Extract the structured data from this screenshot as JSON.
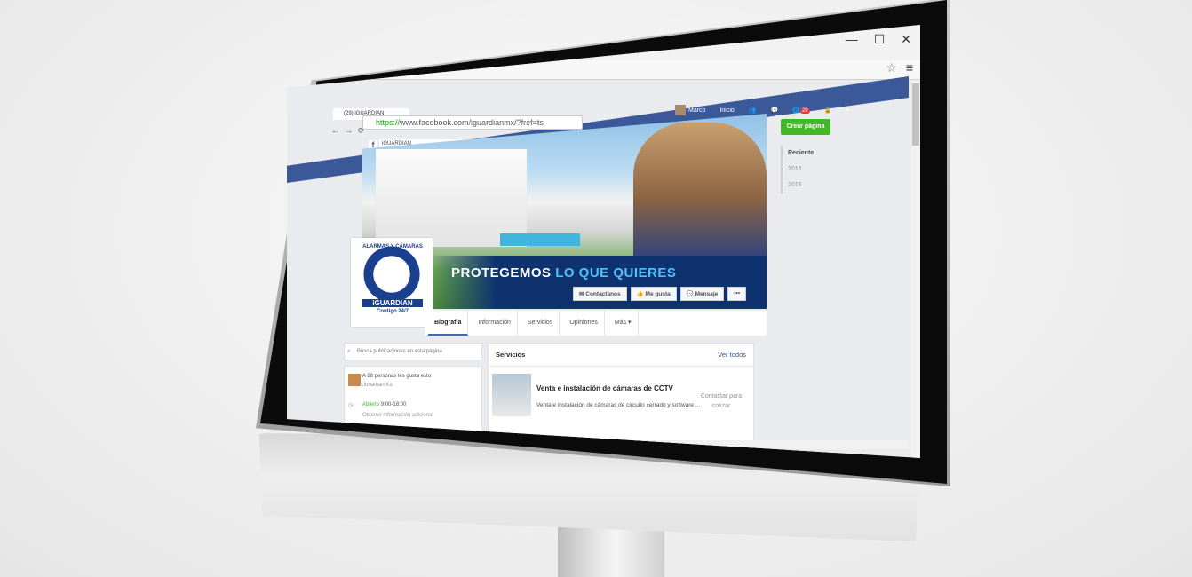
{
  "browser": {
    "tab_title": "(29) iGUARDIAN",
    "url_https": "https://",
    "url_rest": "www.facebook.com/iguardianmx/?fref=ts",
    "window_controls": [
      "—",
      "☐",
      "✕"
    ]
  },
  "facebook": {
    "search_value": "iGUARDIAN",
    "user_name": "Marco",
    "home_label": "Inicio",
    "notification_count": "29"
  },
  "cover": {
    "slogan_main": "PROTEGEMOS",
    "slogan_accent": "LO QUE QUIERES",
    "buttons": {
      "contact": "Contáctanos",
      "like": "Me gusta",
      "message": "Mensaje",
      "more": "•••"
    }
  },
  "profile": {
    "arc_text": "ALARMAS Y CÁMARAS",
    "brand": "iGUARDIAN",
    "tagline": "Contigo 24/7"
  },
  "nav_tabs": [
    "Biografía",
    "Información",
    "Servicios",
    "Opiniones",
    "Más ▾"
  ],
  "left_column": {
    "search_placeholder": "Busca publicaciones en esta página",
    "likes_text": "A 88 personas les gusta esto",
    "liker_name": "Jonathan Ku",
    "open_label": "Abierto",
    "hours": "9:00-18:00",
    "more_info": "Obtener información adicional"
  },
  "services": {
    "header": "Servicios",
    "see_all": "Ver todos",
    "item_title": "Venta e instalación de cámaras de CCTV",
    "item_desc": "Venta e instalación de cámaras de circuito cerrado y software ...",
    "contact": "Contactar para cotizar"
  },
  "right_column": {
    "create_page": "Crear página",
    "timeline": [
      "Reciente",
      "2016",
      "2015"
    ]
  },
  "colors": {
    "facebook_blue": "#3b5998",
    "create_green": "#42b72a",
    "brand_navy": "#1b3f8f",
    "slogan_accent": "#4fc1ff"
  }
}
